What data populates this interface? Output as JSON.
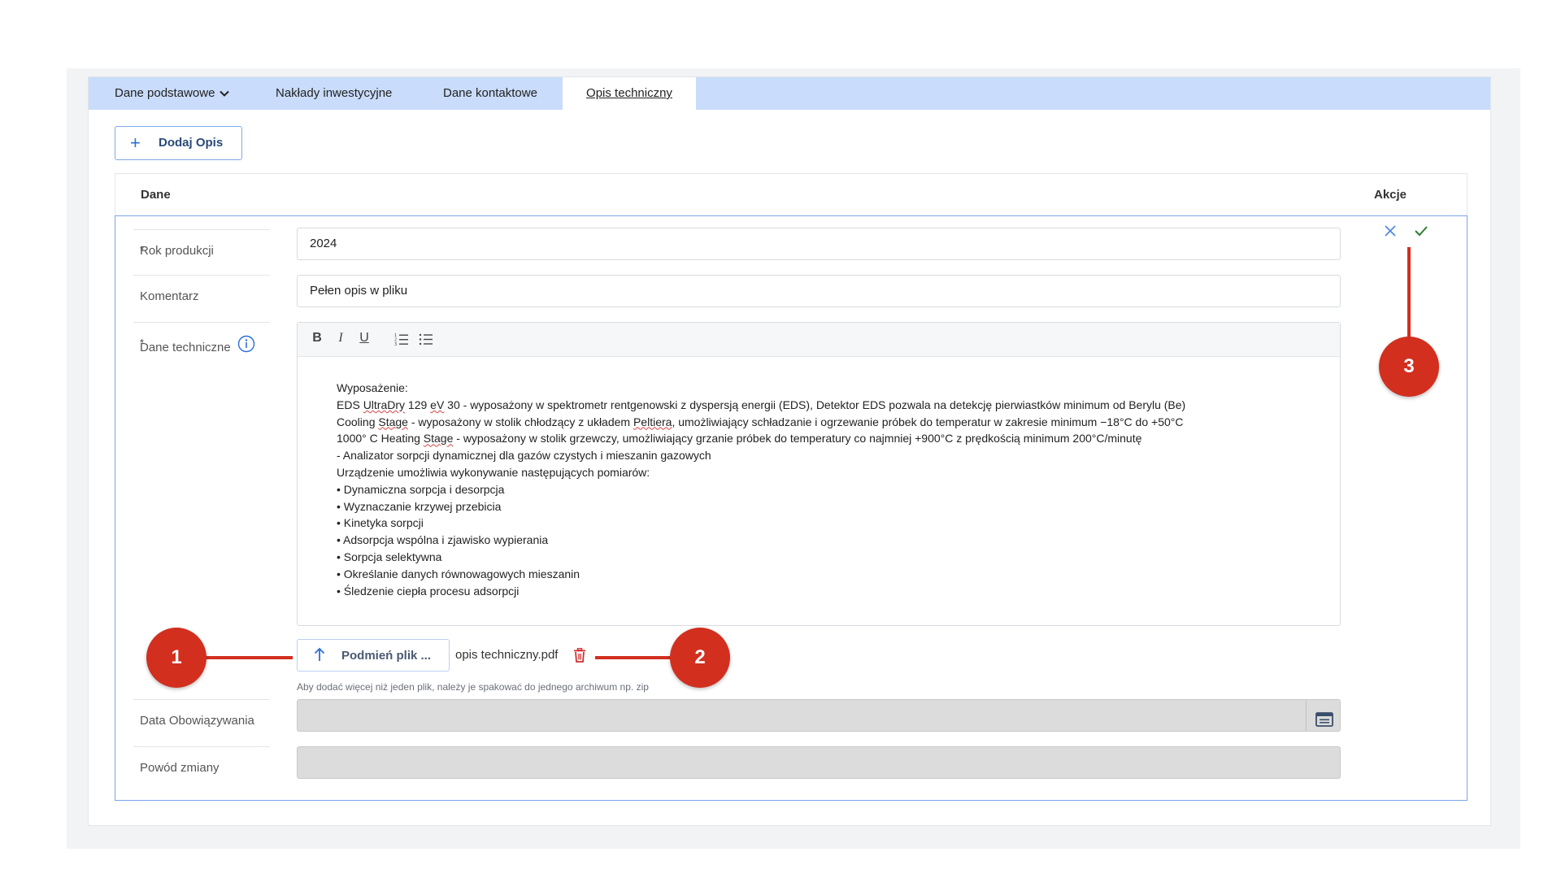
{
  "tabs": [
    {
      "label": "Dane podstawowe",
      "has_dropdown": true,
      "active": false
    },
    {
      "label": "Nakłady inwestycyjne",
      "active": false
    },
    {
      "label": "Dane kontaktowe",
      "active": false
    },
    {
      "label": "Opis techniczny",
      "active": true
    }
  ],
  "add_button": {
    "label": "Dodaj Opis",
    "icon": "plus-icon"
  },
  "table": {
    "col_data": "Dane",
    "col_actions": "Akcje"
  },
  "form": {
    "rok": {
      "required_mark": "*",
      "label": "Rok produkcji",
      "value": "2024"
    },
    "komentarz": {
      "label": "Komentarz",
      "value": "Pełen opis w pliku"
    },
    "dane_techniczne": {
      "required_mark": "*",
      "label": "Dane techniczne",
      "info_icon": "info-icon",
      "toolbar": {
        "bold": "B",
        "italic": "I",
        "underline": "U"
      },
      "lines": [
        "Wyposażenie:",
        "EDS UltraDry 129 eV 30 - wyposażony w spektrometr rentgenowski z dyspersją energii (EDS), Detektor EDS pozwala na detekcję pierwiastków minimum od Berylu (Be)",
        "Cooling Stage - wyposażony w stolik chłodzący z układem Peltiera, umożliwiający schładzanie i ogrzewanie próbek do temperatur w zakresie minimum −18°C do +50°C",
        "1000° C Heating Stage - wyposażony w stolik grzewczy, umożliwiający grzanie próbek do temperatury co najmniej +900°C z prędkością minimum 200°C/minutę",
        "- Analizator sorpcji dynamicznej dla gazów czystych i mieszanin gazowych",
        "Urządzenie umożliwia wykonywanie następujących pomiarów:",
        "• Dynamiczna sorpcja i desorpcja",
        "• Wyznaczanie krzywej przebicia",
        "• Kinetyka sorpcji",
        "• Adsorpcja wspólna i zjawisko wypierania",
        "• Sorpcja selektywna",
        "• Określanie danych równowagowych mieszanin",
        "• Śledzenie ciepła procesu adsorpcji"
      ]
    },
    "upload": {
      "button_label": "Podmień plik ...",
      "filename": "opis techniczny.pdf",
      "hint": "Aby dodać więcej niż jeden plik, należy je spakować do jednego archiwum np. zip"
    },
    "data_obowiazywania": {
      "label": "Data Obowiązywania",
      "value": ""
    },
    "powod_zmiany": {
      "label": "Powód zmiany",
      "value": ""
    }
  },
  "callouts": [
    "1",
    "2",
    "3"
  ],
  "colors": {
    "tabbar": "#c9dcfb",
    "accent": "#2a6fd8",
    "callout": "#d22f1f",
    "confirm": "#2e7d32",
    "delete": "#d32f2f"
  }
}
